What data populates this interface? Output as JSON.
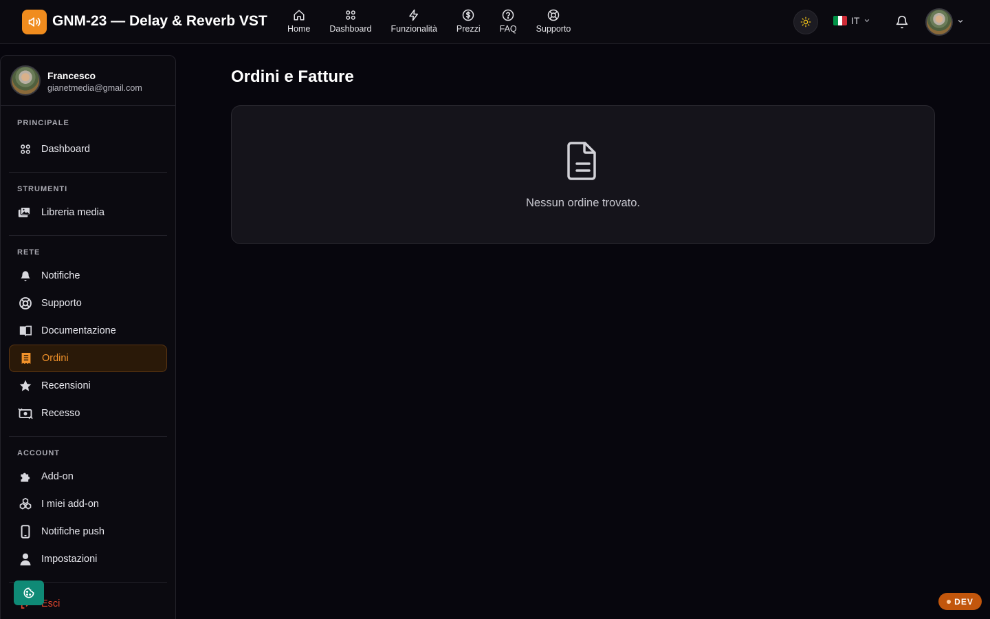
{
  "app": {
    "title": "GNM-23 — Delay & Reverb VST",
    "accent_color": "#f08c1e"
  },
  "nav": [
    {
      "label": "Home",
      "icon": "home-icon"
    },
    {
      "label": "Dashboard",
      "icon": "grid-icon"
    },
    {
      "label": "Funzionalità",
      "icon": "bolt-icon"
    },
    {
      "label": "Prezzi",
      "icon": "dollar-circle-icon"
    },
    {
      "label": "FAQ",
      "icon": "question-circle-icon"
    },
    {
      "label": "Supporto",
      "icon": "lifebuoy-icon"
    }
  ],
  "header": {
    "language_code": "IT",
    "flag_colors": [
      "#009246",
      "#ffffff",
      "#ce2b37"
    ]
  },
  "user": {
    "name": "Francesco",
    "email": "gianetmedia@gmail.com"
  },
  "sidebar": {
    "sections": [
      {
        "title": "PRINCIPALE",
        "items": [
          {
            "label": "Dashboard",
            "icon": "grid-icon"
          }
        ]
      },
      {
        "title": "STRUMENTI",
        "items": [
          {
            "label": "Libreria media",
            "icon": "photos-icon"
          }
        ]
      },
      {
        "title": "RETE",
        "items": [
          {
            "label": "Notifiche",
            "icon": "bell-icon"
          },
          {
            "label": "Supporto",
            "icon": "lifebuoy-icon"
          },
          {
            "label": "Documentazione",
            "icon": "book-icon"
          },
          {
            "label": "Ordini",
            "icon": "receipt-icon",
            "active": true
          },
          {
            "label": "Recensioni",
            "icon": "star-icon"
          },
          {
            "label": "Recesso",
            "icon": "money-return-icon"
          }
        ]
      },
      {
        "title": "ACCOUNT",
        "items": [
          {
            "label": "Add-on",
            "icon": "puzzle-icon"
          },
          {
            "label": "I miei add-on",
            "icon": "cubes-icon"
          },
          {
            "label": "Notifiche push",
            "icon": "phone-icon"
          },
          {
            "label": "Impostazioni",
            "icon": "user-icon"
          }
        ]
      }
    ],
    "logout_label": "Esci"
  },
  "main": {
    "title": "Ordini e Fatture",
    "empty_message": "Nessun ordine trovato."
  },
  "badges": {
    "dev": "DEV"
  }
}
